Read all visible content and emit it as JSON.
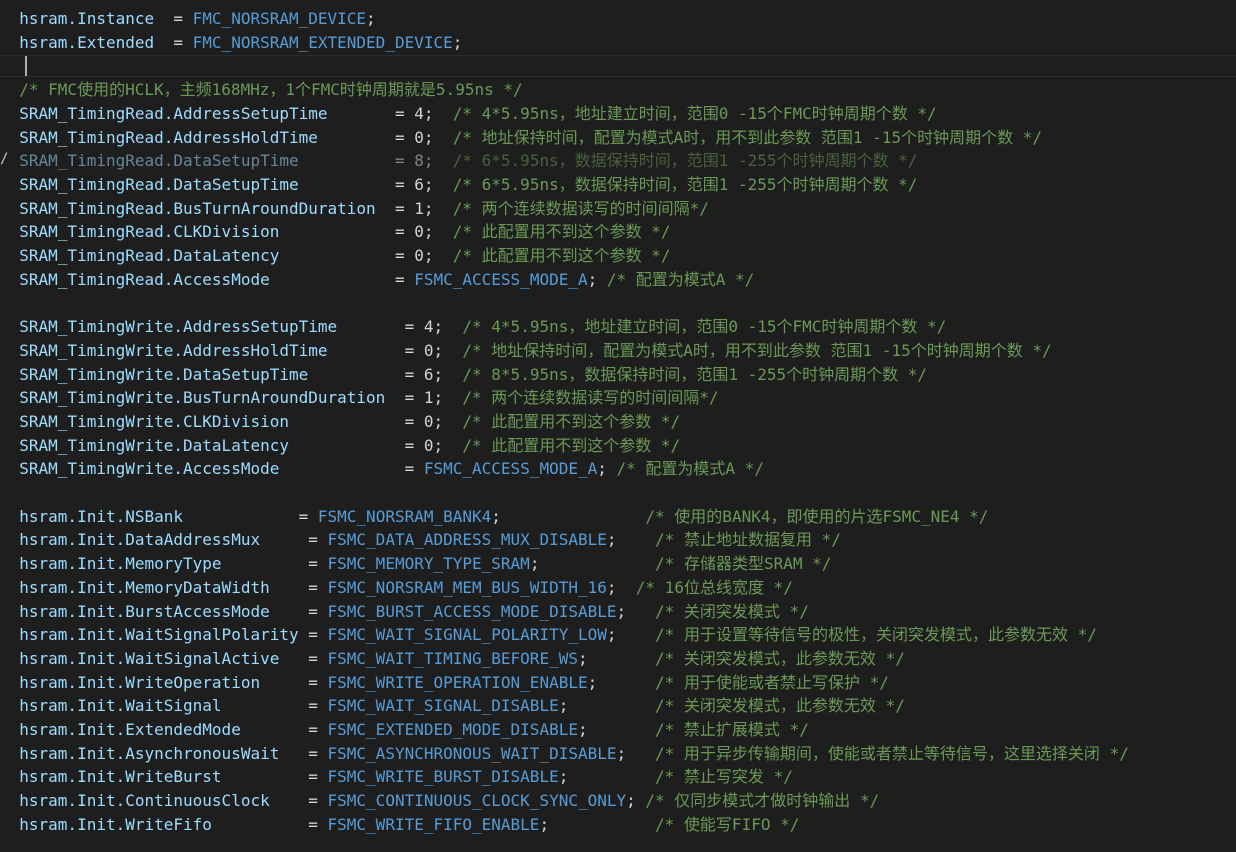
{
  "editor": {
    "lines": [
      {
        "segments": [
          {
            "t": "  hsram.Instance  ",
            "c": "prop"
          },
          {
            "t": "= ",
            "c": "pun"
          },
          {
            "t": "FMC_NORSRAM_DEVICE",
            "c": "mac"
          },
          {
            "t": ";",
            "c": "pun"
          }
        ]
      },
      {
        "segments": [
          {
            "t": "  hsram.Extended  ",
            "c": "prop"
          },
          {
            "t": "= ",
            "c": "pun"
          },
          {
            "t": "FMC_NORSRAM_EXTENDED_DEVICE",
            "c": "mac"
          },
          {
            "t": ";",
            "c": "pun"
          }
        ]
      },
      {
        "segments": [],
        "current": true
      },
      {
        "segments": [
          {
            "t": "  /* FMC使用的HCLK，主频168MHz，1个FMC时钟周期就是5.95ns */",
            "c": "com"
          }
        ]
      },
      {
        "segments": [
          {
            "t": "  SRAM_TimingRead.AddressSetupTime      ",
            "c": "prop"
          },
          {
            "t": " = 4;  ",
            "c": "pun"
          },
          {
            "t": "/* 4*5.95ns，地址建立时间，范围0 -15个FMC时钟周期个数 */",
            "c": "com"
          }
        ]
      },
      {
        "segments": [
          {
            "t": "  SRAM_TimingRead.AddressHoldTime       ",
            "c": "prop"
          },
          {
            "t": " = 0;  ",
            "c": "pun"
          },
          {
            "t": "/* 地址保持时间，配置为模式A时，用不到此参数 范围1 -15个时钟周期个数 */",
            "c": "com"
          }
        ]
      },
      {
        "segments": [
          {
            "t": "  SRAM_TimingRead.DataSetupTime         ",
            "c": "prop"
          },
          {
            "t": " = 8;  ",
            "c": "pun"
          },
          {
            "t": "/* 6*5.95ns，数据保持时间，范围1 -255个时钟周期个数 */",
            "c": "com"
          }
        ],
        "ghost": true,
        "mark": "/"
      },
      {
        "segments": [
          {
            "t": "  SRAM_TimingRead.DataSetupTime         ",
            "c": "prop"
          },
          {
            "t": " = 6;  ",
            "c": "pun"
          },
          {
            "t": "/* 6*5.95ns，数据保持时间，范围1 -255个时钟周期个数 */",
            "c": "com"
          }
        ]
      },
      {
        "segments": [
          {
            "t": "  SRAM_TimingRead.BusTurnAroundDuration ",
            "c": "prop"
          },
          {
            "t": " = 1;  ",
            "c": "pun"
          },
          {
            "t": "/* 两个连续数据读写的时间间隔*/",
            "c": "com"
          }
        ]
      },
      {
        "segments": [
          {
            "t": "  SRAM_TimingRead.CLKDivision           ",
            "c": "prop"
          },
          {
            "t": " = 0;  ",
            "c": "pun"
          },
          {
            "t": "/* 此配置用不到这个参数 */",
            "c": "com"
          }
        ]
      },
      {
        "segments": [
          {
            "t": "  SRAM_TimingRead.DataLatency           ",
            "c": "prop"
          },
          {
            "t": " = 0;  ",
            "c": "pun"
          },
          {
            "t": "/* 此配置用不到这个参数 */",
            "c": "com"
          }
        ]
      },
      {
        "segments": [
          {
            "t": "  SRAM_TimingRead.AccessMode            ",
            "c": "prop"
          },
          {
            "t": " = ",
            "c": "pun"
          },
          {
            "t": "FSMC_ACCESS_MODE_A",
            "c": "mac-u"
          },
          {
            "t": "; ",
            "c": "pun"
          },
          {
            "t": "/* 配置为模式A */",
            "c": "com"
          }
        ]
      },
      {
        "segments": []
      },
      {
        "segments": [
          {
            "t": "  SRAM_TimingWrite.AddressSetupTime      ",
            "c": "prop"
          },
          {
            "t": " = 4;  ",
            "c": "pun"
          },
          {
            "t": "/* 4*5.95ns，地址建立时间，范围0 -15个FMC时钟周期个数 */",
            "c": "com"
          }
        ]
      },
      {
        "segments": [
          {
            "t": "  SRAM_TimingWrite.AddressHoldTime       ",
            "c": "prop"
          },
          {
            "t": " = 0;  ",
            "c": "pun"
          },
          {
            "t": "/* 地址保持时间，配置为模式A时，用不到此参数 范围1 -15个时钟周期个数 */",
            "c": "com"
          }
        ]
      },
      {
        "segments": [
          {
            "t": "  SRAM_TimingWrite.DataSetupTime         ",
            "c": "prop"
          },
          {
            "t": " = 6;  ",
            "c": "pun"
          },
          {
            "t": "/* 8*5.95ns，数据保持时间，范围1 -255个时钟周期个数 */",
            "c": "com"
          }
        ]
      },
      {
        "segments": [
          {
            "t": "  SRAM_TimingWrite.BusTurnAroundDuration ",
            "c": "prop"
          },
          {
            "t": " = 1;  ",
            "c": "pun"
          },
          {
            "t": "/* 两个连续数据读写的时间间隔*/",
            "c": "com"
          }
        ]
      },
      {
        "segments": [
          {
            "t": "  SRAM_TimingWrite.CLKDivision           ",
            "c": "prop"
          },
          {
            "t": " = 0;  ",
            "c": "pun"
          },
          {
            "t": "/* 此配置用不到这个参数 */",
            "c": "com"
          }
        ]
      },
      {
        "segments": [
          {
            "t": "  SRAM_TimingWrite.DataLatency           ",
            "c": "prop"
          },
          {
            "t": " = 0;  ",
            "c": "pun"
          },
          {
            "t": "/* 此配置用不到这个参数 */",
            "c": "com"
          }
        ]
      },
      {
        "segments": [
          {
            "t": "  SRAM_TimingWrite.AccessMode            ",
            "c": "prop"
          },
          {
            "t": " = ",
            "c": "pun"
          },
          {
            "t": "FSMC_ACCESS_MODE_A",
            "c": "mac-u"
          },
          {
            "t": "; ",
            "c": "pun"
          },
          {
            "t": "/* 配置为模式A */",
            "c": "com"
          }
        ]
      },
      {
        "segments": []
      },
      {
        "segments": [
          {
            "t": "  hsram.Init.NSBank            ",
            "c": "prop"
          },
          {
            "t": "= ",
            "c": "pun"
          },
          {
            "t": "FSMC_NORSRAM_BANK4",
            "c": "mac-u"
          },
          {
            "t": ";               ",
            "c": "pun"
          },
          {
            "t": "/* 使用的BANK4，即使用的片选FSMC_NE4 */",
            "c": "com"
          }
        ]
      },
      {
        "segments": [
          {
            "t": "  hsram.Init.DataAddressMux     ",
            "c": "prop"
          },
          {
            "t": "= ",
            "c": "pun"
          },
          {
            "t": "FSMC_DATA_ADDRESS_MUX_DISABLE",
            "c": "mac-u"
          },
          {
            "t": ";    ",
            "c": "pun"
          },
          {
            "t": "/* 禁止地址数据复用 */",
            "c": "com"
          }
        ]
      },
      {
        "segments": [
          {
            "t": "  hsram.Init.MemoryType         ",
            "c": "prop"
          },
          {
            "t": "= ",
            "c": "pun"
          },
          {
            "t": "FSMC_MEMORY_TYPE_SRAM",
            "c": "mac-u"
          },
          {
            "t": ";            ",
            "c": "pun"
          },
          {
            "t": "/* 存储器类型SRAM */",
            "c": "com"
          }
        ]
      },
      {
        "segments": [
          {
            "t": "  hsram.Init.MemoryDataWidth    ",
            "c": "prop"
          },
          {
            "t": "= ",
            "c": "pun"
          },
          {
            "t": "FSMC_NORSRAM_MEM_BUS_WIDTH_16",
            "c": "mac-u"
          },
          {
            "t": ";  ",
            "c": "pun"
          },
          {
            "t": "/* 16位总线宽度 */",
            "c": "com"
          }
        ]
      },
      {
        "segments": [
          {
            "t": "  hsram.Init.BurstAccessMode    ",
            "c": "prop"
          },
          {
            "t": "= ",
            "c": "pun"
          },
          {
            "t": "FSMC_BURST_ACCESS_MODE_DISABLE",
            "c": "mac-u"
          },
          {
            "t": ";   ",
            "c": "pun"
          },
          {
            "t": "/* 关闭突发模式 */",
            "c": "com"
          }
        ]
      },
      {
        "segments": [
          {
            "t": "  hsram.Init.WaitSignalPolarity ",
            "c": "prop"
          },
          {
            "t": "= ",
            "c": "pun"
          },
          {
            "t": "FSMC_WAIT_SIGNAL_POLARITY_LOW",
            "c": "mac-u"
          },
          {
            "t": ";    ",
            "c": "pun"
          },
          {
            "t": "/* 用于设置等待信号的极性，关闭突发模式，此参数无效 */",
            "c": "com"
          }
        ]
      },
      {
        "segments": [
          {
            "t": "  hsram.Init.WaitSignalActive   ",
            "c": "prop"
          },
          {
            "t": "= ",
            "c": "pun"
          },
          {
            "t": "FSMC_WAIT_TIMING_BEFORE_WS",
            "c": "mac-u"
          },
          {
            "t": ";       ",
            "c": "pun"
          },
          {
            "t": "/* 关闭突发模式，此参数无效 */",
            "c": "com"
          }
        ]
      },
      {
        "segments": [
          {
            "t": "  hsram.Init.WriteOperation     ",
            "c": "prop"
          },
          {
            "t": "= ",
            "c": "pun"
          },
          {
            "t": "FSMC_WRITE_OPERATION_ENABLE",
            "c": "mac-u"
          },
          {
            "t": ";      ",
            "c": "pun"
          },
          {
            "t": "/* 用于使能或者禁止写保护 */",
            "c": "com"
          }
        ]
      },
      {
        "segments": [
          {
            "t": "  hsram.Init.WaitSignal         ",
            "c": "prop"
          },
          {
            "t": "= ",
            "c": "pun"
          },
          {
            "t": "FSMC_WAIT_SIGNAL_DISABLE",
            "c": "mac-u"
          },
          {
            "t": ";         ",
            "c": "pun"
          },
          {
            "t": "/* 关闭突发模式，此参数无效 */",
            "c": "com"
          }
        ]
      },
      {
        "segments": [
          {
            "t": "  hsram.Init.ExtendedMode       ",
            "c": "prop"
          },
          {
            "t": "= ",
            "c": "pun"
          },
          {
            "t": "FSMC_EXTENDED_MODE_DISABLE",
            "c": "mac-u"
          },
          {
            "t": ";       ",
            "c": "pun"
          },
          {
            "t": "/* 禁止扩展模式 */",
            "c": "com"
          }
        ]
      },
      {
        "segments": [
          {
            "t": "  hsram.Init.AsynchronousWait   ",
            "c": "prop"
          },
          {
            "t": "= ",
            "c": "pun"
          },
          {
            "t": "FSMC_ASYNCHRONOUS_WAIT_DISABLE",
            "c": "mac-u"
          },
          {
            "t": ";   ",
            "c": "pun"
          },
          {
            "t": "/* 用于异步传输期间，使能或者禁止等待信号，这里选择关闭 */",
            "c": "com"
          }
        ]
      },
      {
        "segments": [
          {
            "t": "  hsram.Init.WriteBurst         ",
            "c": "prop"
          },
          {
            "t": "= ",
            "c": "pun"
          },
          {
            "t": "FSMC_WRITE_BURST_DISABLE",
            "c": "mac-u"
          },
          {
            "t": ";         ",
            "c": "pun"
          },
          {
            "t": "/* 禁止写突发 */",
            "c": "com"
          }
        ]
      },
      {
        "segments": [
          {
            "t": "  hsram.Init.ContinuousClock    ",
            "c": "prop"
          },
          {
            "t": "= ",
            "c": "pun"
          },
          {
            "t": "FSMC_CONTINUOUS_CLOCK_SYNC_ONLY",
            "c": "mac-u"
          },
          {
            "t": "; ",
            "c": "pun"
          },
          {
            "t": "/* 仅同步模式才做时钟输出 */",
            "c": "com"
          }
        ]
      },
      {
        "segments": [
          {
            "t": "  hsram.Init.WriteFifo          ",
            "c": "prop"
          },
          {
            "t": "= ",
            "c": "pun"
          },
          {
            "t": "FSMC_WRITE_FIFO_ENABLE",
            "c": "mac-u"
          },
          {
            "t": ";           ",
            "c": "pun"
          },
          {
            "t": "/* 使能写FIFO */",
            "c": "com"
          }
        ]
      }
    ]
  }
}
